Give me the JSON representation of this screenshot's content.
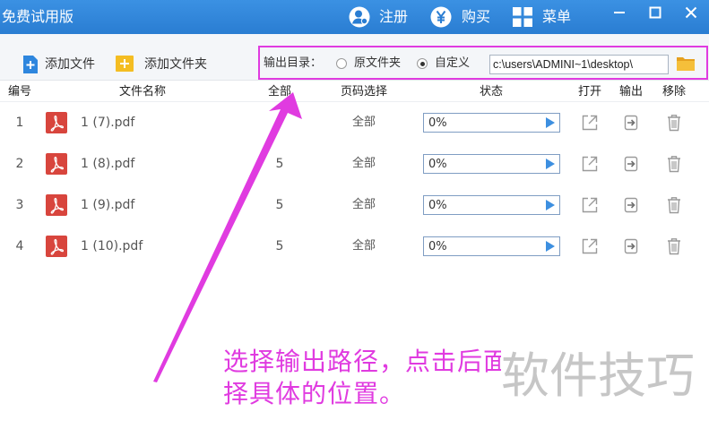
{
  "window": {
    "title": "免费试用版",
    "actions": [
      {
        "icon": "user-icon",
        "label": "注册"
      },
      {
        "icon": "yen-icon",
        "label": "购买"
      },
      {
        "icon": "grid-icon",
        "label": "菜单"
      }
    ],
    "controls": [
      "minimize-icon",
      "maximize-icon",
      "close-icon"
    ]
  },
  "toolbar": {
    "add_file": {
      "icon": "file-plus-icon",
      "label": "添加文件"
    },
    "add_folder": {
      "icon": "folder-plus-icon",
      "label": "添加文件夹"
    }
  },
  "output": {
    "label": "输出目录：",
    "options": [
      {
        "label": "原文件夹",
        "selected": false
      },
      {
        "label": "自定义",
        "selected": true
      }
    ],
    "path": "c:\\users\\ADMINI~1\\desktop\\",
    "browse_icon": "folder-icon"
  },
  "table": {
    "columns": [
      "编号",
      "文件名称",
      "全部",
      "页码选择",
      "状态",
      "打开",
      "输出",
      "移除"
    ],
    "rows": [
      {
        "no": "1",
        "name": "1 (7).pdf",
        "range": "全部",
        "progress": "0%"
      },
      {
        "no": "2",
        "name": "1 (8).pdf",
        "pages": "5",
        "range": "全部",
        "progress": "0%"
      },
      {
        "no": "3",
        "name": "1 (9).pdf",
        "pages": "5",
        "range": "全部",
        "progress": "0%"
      },
      {
        "no": "4",
        "name": "1 (10).pdf",
        "pages": "5",
        "range": "全部",
        "progress": "0%"
      }
    ],
    "row_icons": [
      "pdf-file-icon",
      "play-icon",
      "open-icon",
      "output-icon",
      "trash-icon"
    ]
  },
  "annotation": {
    "lines": [
      "选择输出路径，点击后面",
      "择具体的位置。"
    ]
  },
  "watermark": "软件技巧",
  "colors": {
    "titlebar": "#2f84d8",
    "annotation_magenta": "#e03be0",
    "pdf_red": "#d8453d",
    "folder_yellow": "#f4bd22",
    "play_blue": "#3d8fe0"
  }
}
